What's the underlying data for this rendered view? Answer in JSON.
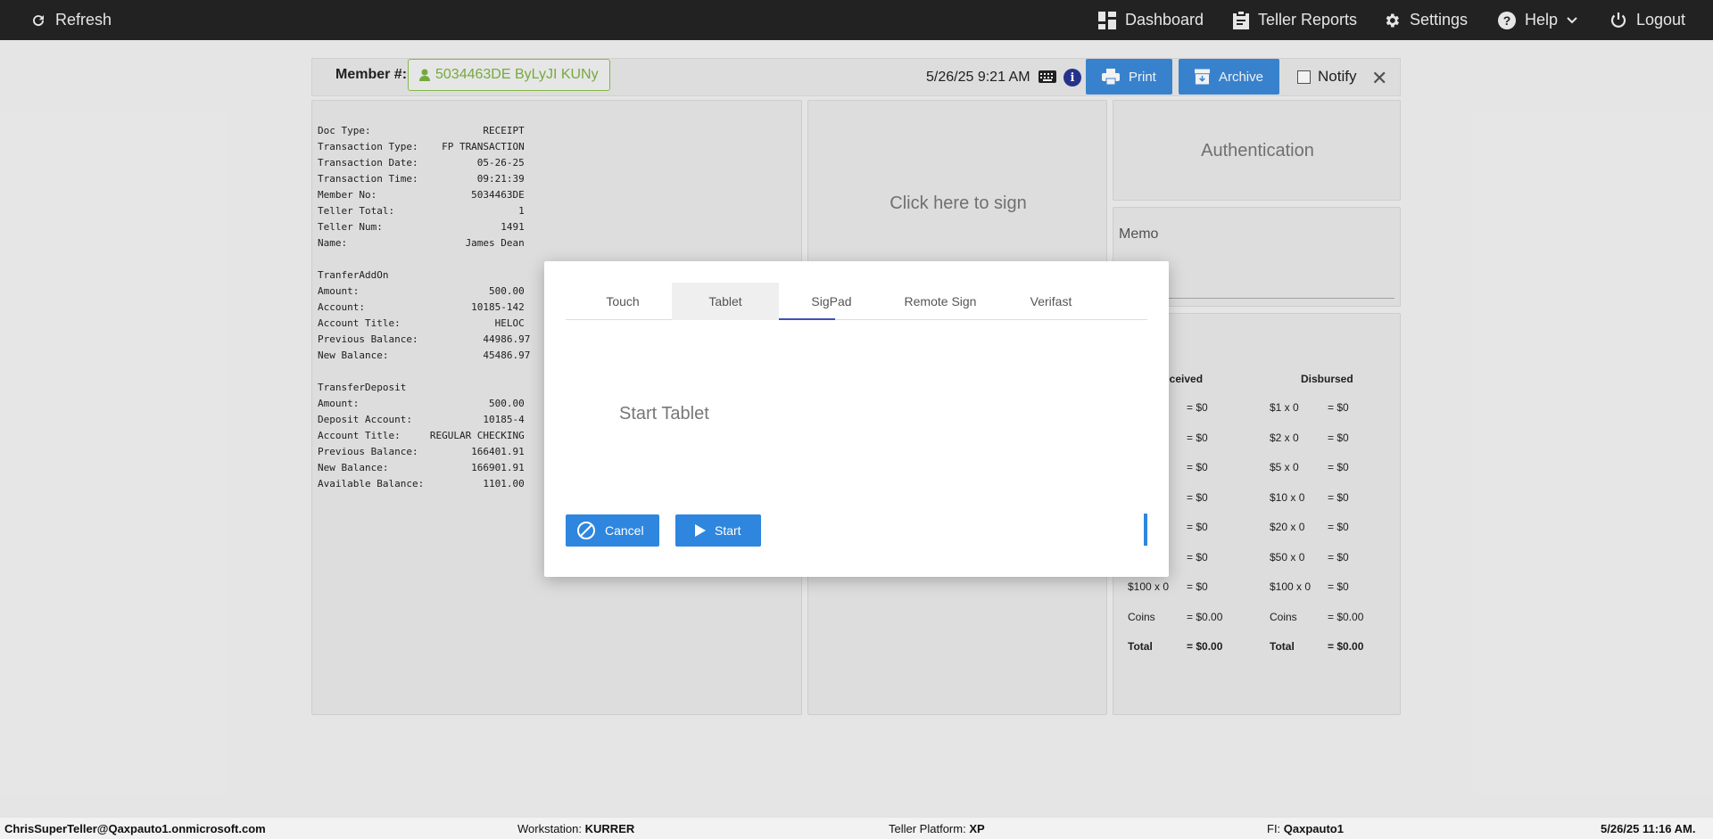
{
  "topbar": {
    "refresh": "Refresh",
    "dashboard": "Dashboard",
    "teller_reports": "Teller Reports",
    "settings": "Settings",
    "help": "Help",
    "logout": "Logout"
  },
  "header": {
    "member_label": "Member #:",
    "member_value": "5034463DE ByLyJI KUNy",
    "datetime": "5/26/25 9:21 AM",
    "print": "Print",
    "archive": "Archive",
    "notify": "Notify"
  },
  "receipt": {
    "lines": [
      "Doc Type:                   RECEIPT",
      "Transaction Type:    FP TRANSACTION",
      "Transaction Date:          05-26-25",
      "Transaction Time:          09:21:39",
      "Member No:                5034463DE",
      "Teller Total:                     1",
      "Teller Num:                    1491",
      "Name:                    James Dean",
      "",
      "TranferAddOn",
      "Amount:                      500.00",
      "Account:                  10185-142",
      "Account Title:                HELOC",
      "Previous Balance:           44986.97",
      "New Balance:                45486.97",
      "",
      "TransferDeposit",
      "Amount:                      500.00",
      "Deposit Account:            10185-4",
      "Account Title:     REGULAR CHECKING",
      "Previous Balance:         166401.91",
      "New Balance:              166901.91",
      "Available Balance:          1101.00"
    ]
  },
  "sign_panel": {
    "text": "Click here to sign"
  },
  "auth_panel": {
    "text": "Authentication"
  },
  "memo_panel": {
    "label": "Memo"
  },
  "cash": {
    "received_header": "eceived",
    "disbursed_header": "Disbursed",
    "received_rows": [
      {
        "label": "",
        "value": "= $0"
      },
      {
        "label": "",
        "value": "= $0"
      },
      {
        "label": "",
        "value": "= $0"
      },
      {
        "label": "",
        "value": "= $0"
      },
      {
        "label": "",
        "value": "= $0"
      },
      {
        "label": "",
        "value": "= $0"
      },
      {
        "label": "$100 x 0",
        "value": "= $0"
      },
      {
        "label": "Coins",
        "value": "= $0.00"
      }
    ],
    "disbursed_rows": [
      {
        "label": "$1 x 0",
        "value": "= $0"
      },
      {
        "label": "$2 x 0",
        "value": "= $0"
      },
      {
        "label": "$5 x 0",
        "value": "= $0"
      },
      {
        "label": "$10 x 0",
        "value": "= $0"
      },
      {
        "label": "$20 x 0",
        "value": "= $0"
      },
      {
        "label": "$50 x 0",
        "value": "= $0"
      },
      {
        "label": "$100 x 0",
        "value": "= $0"
      },
      {
        "label": "Coins",
        "value": "= $0.00"
      }
    ],
    "total_label": "Total",
    "received_total": "= $0.00",
    "disbursed_total": "= $0.00"
  },
  "modal": {
    "tabs": [
      "Touch",
      "Tablet",
      "SigPad",
      "Remote Sign",
      "Verifast"
    ],
    "active_tab": "Tablet",
    "content_text": "Start Tablet",
    "cancel": "Cancel",
    "start": "Start"
  },
  "statusbar": {
    "user": "ChrisSuperTeller@Qaxpauto1.onmicrosoft.com",
    "workstation_label": "Workstation:",
    "workstation_value": "KURRER",
    "platform_label": "Teller Platform:",
    "platform_value": "XP",
    "fi_label": "FI:",
    "fi_value": "Qaxpauto1",
    "datetime": "5/26/25 11:16 AM."
  }
}
